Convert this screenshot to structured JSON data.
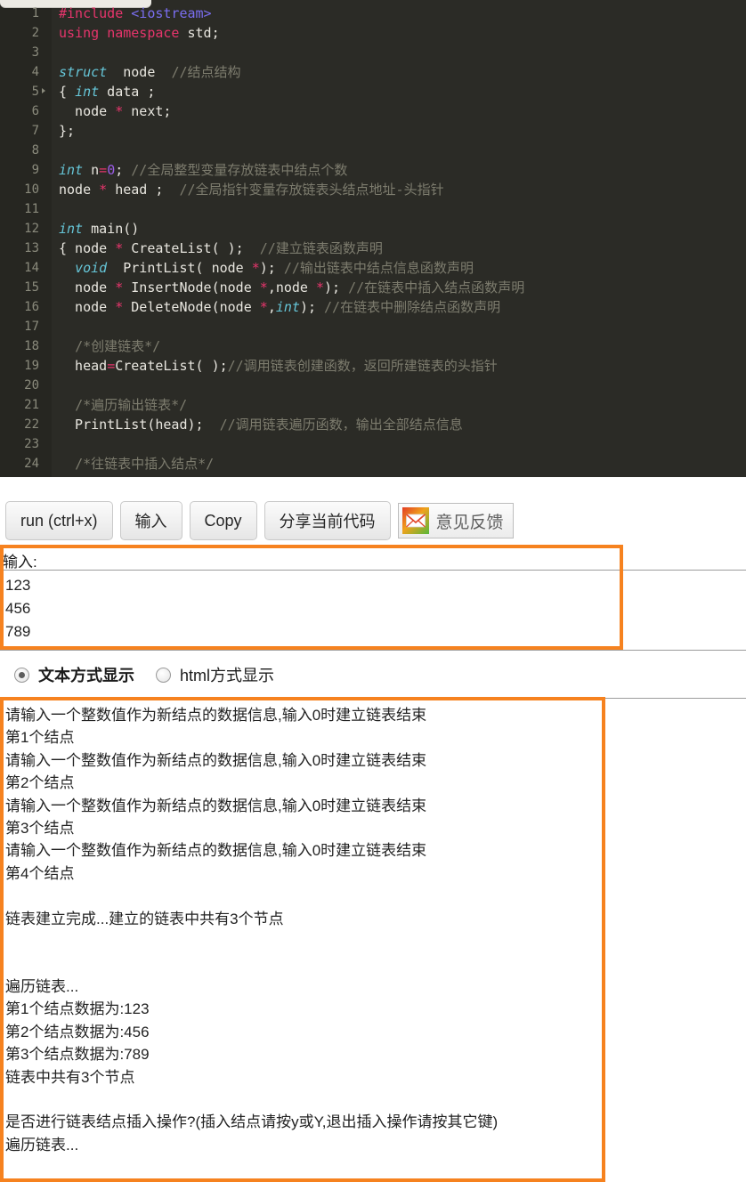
{
  "editor": {
    "language": "cpp",
    "colors": {
      "background": "#2b2b26",
      "gutter": "#262621",
      "text": "#e8e6df",
      "keyword": "#e6356c",
      "type": "#66c6d8",
      "string": "#7a6ef0",
      "number": "#9b5ce6",
      "comment": "#7d7c6e"
    },
    "lines": [
      {
        "n": "1",
        "fold": false,
        "tokens": [
          {
            "t": "#include",
            "c": "kw"
          },
          {
            "t": " ",
            "c": ""
          },
          {
            "t": "<iostream>",
            "c": "str"
          }
        ]
      },
      {
        "n": "2",
        "fold": false,
        "tokens": [
          {
            "t": "using",
            "c": "kw"
          },
          {
            "t": " ",
            "c": ""
          },
          {
            "t": "namespace",
            "c": "kw"
          },
          {
            "t": " std;",
            "c": ""
          }
        ]
      },
      {
        "n": "3",
        "fold": false,
        "tokens": []
      },
      {
        "n": "4",
        "fold": false,
        "tokens": [
          {
            "t": "struct",
            "c": "typ"
          },
          {
            "t": "  node  ",
            "c": ""
          },
          {
            "t": "//结点结构",
            "c": "cmt"
          }
        ]
      },
      {
        "n": "5",
        "fold": true,
        "tokens": [
          {
            "t": "{ ",
            "c": ""
          },
          {
            "t": "int",
            "c": "typ"
          },
          {
            "t": " data ;",
            "c": ""
          }
        ]
      },
      {
        "n": "6",
        "fold": false,
        "tokens": [
          {
            "t": "  node ",
            "c": ""
          },
          {
            "t": "*",
            "c": "op"
          },
          {
            "t": " next;",
            "c": ""
          }
        ]
      },
      {
        "n": "7",
        "fold": false,
        "tokens": [
          {
            "t": "};",
            "c": ""
          }
        ]
      },
      {
        "n": "8",
        "fold": false,
        "tokens": []
      },
      {
        "n": "9",
        "fold": false,
        "tokens": [
          {
            "t": "int",
            "c": "typ"
          },
          {
            "t": " n",
            "c": ""
          },
          {
            "t": "=",
            "c": "kw"
          },
          {
            "t": "0",
            "c": "num"
          },
          {
            "t": "; ",
            "c": ""
          },
          {
            "t": "//全局整型变量存放链表中结点个数",
            "c": "cmt"
          }
        ]
      },
      {
        "n": "10",
        "fold": false,
        "tokens": [
          {
            "t": "node ",
            "c": ""
          },
          {
            "t": "*",
            "c": "op"
          },
          {
            "t": " head ;  ",
            "c": ""
          },
          {
            "t": "//全局指针变量存放链表头结点地址-头指针",
            "c": "cmt"
          }
        ]
      },
      {
        "n": "11",
        "fold": false,
        "tokens": []
      },
      {
        "n": "12",
        "fold": false,
        "tokens": [
          {
            "t": "int",
            "c": "typ"
          },
          {
            "t": " main()",
            "c": ""
          }
        ]
      },
      {
        "n": "13",
        "fold": false,
        "tokens": [
          {
            "t": "{ node ",
            "c": ""
          },
          {
            "t": "*",
            "c": "op"
          },
          {
            "t": " CreateList( );  ",
            "c": ""
          },
          {
            "t": "//建立链表函数声明",
            "c": "cmt"
          }
        ]
      },
      {
        "n": "14",
        "fold": false,
        "tokens": [
          {
            "t": "  ",
            "c": ""
          },
          {
            "t": "void",
            "c": "typ"
          },
          {
            "t": "  PrintList( node ",
            "c": ""
          },
          {
            "t": "*",
            "c": "op"
          },
          {
            "t": "); ",
            "c": ""
          },
          {
            "t": "//输出链表中结点信息函数声明",
            "c": "cmt"
          }
        ]
      },
      {
        "n": "15",
        "fold": false,
        "tokens": [
          {
            "t": "  node ",
            "c": ""
          },
          {
            "t": "*",
            "c": "op"
          },
          {
            "t": " InsertNode(node ",
            "c": ""
          },
          {
            "t": "*",
            "c": "op"
          },
          {
            "t": ",node ",
            "c": ""
          },
          {
            "t": "*",
            "c": "op"
          },
          {
            "t": "); ",
            "c": ""
          },
          {
            "t": "//在链表中插入结点函数声明",
            "c": "cmt"
          }
        ]
      },
      {
        "n": "16",
        "fold": false,
        "tokens": [
          {
            "t": "  node ",
            "c": ""
          },
          {
            "t": "*",
            "c": "op"
          },
          {
            "t": " DeleteNode(node ",
            "c": ""
          },
          {
            "t": "*",
            "c": "op"
          },
          {
            "t": ",",
            "c": ""
          },
          {
            "t": "int",
            "c": "typ"
          },
          {
            "t": "); ",
            "c": ""
          },
          {
            "t": "//在链表中删除结点函数声明",
            "c": "cmt"
          }
        ]
      },
      {
        "n": "17",
        "fold": false,
        "tokens": []
      },
      {
        "n": "18",
        "fold": false,
        "tokens": [
          {
            "t": "  ",
            "c": ""
          },
          {
            "t": "/*创建链表*/",
            "c": "cmt"
          }
        ]
      },
      {
        "n": "19",
        "fold": false,
        "tokens": [
          {
            "t": "  head",
            "c": ""
          },
          {
            "t": "=",
            "c": "kw"
          },
          {
            "t": "CreateList( );",
            "c": ""
          },
          {
            "t": "//调用链表创建函数，返回所建链表的头指针",
            "c": "cmt"
          }
        ]
      },
      {
        "n": "20",
        "fold": false,
        "tokens": []
      },
      {
        "n": "21",
        "fold": false,
        "tokens": [
          {
            "t": "  ",
            "c": ""
          },
          {
            "t": "/*遍历输出链表*/",
            "c": "cmt"
          }
        ]
      },
      {
        "n": "22",
        "fold": false,
        "tokens": [
          {
            "t": "  PrintList(head);  ",
            "c": ""
          },
          {
            "t": "//调用链表遍历函数，输出全部结点信息",
            "c": "cmt"
          }
        ]
      },
      {
        "n": "23",
        "fold": false,
        "tokens": []
      },
      {
        "n": "24",
        "fold": false,
        "tokens": [
          {
            "t": "  ",
            "c": ""
          },
          {
            "t": "/*往链表中插入结点*/",
            "c": "cmt"
          }
        ]
      }
    ]
  },
  "toolbar": {
    "run_label": "run (ctrl+x)",
    "input_label": "输入",
    "copy_label": "Copy",
    "share_label": "分享当前代码",
    "feedback_label": "意见反馈",
    "feedback_icon": "envelope-icon"
  },
  "input_panel": {
    "label": "输入:",
    "lines": [
      "123",
      "456",
      "789"
    ]
  },
  "display_mode": {
    "options": [
      {
        "label": "文本方式显示",
        "selected": true
      },
      {
        "label": "html方式显示",
        "selected": false
      }
    ]
  },
  "output_panel": {
    "text": "请输入一个整数值作为新结点的数据信息,输入0时建立链表结束\n第1个结点\n请输入一个整数值作为新结点的数据信息,输入0时建立链表结束\n第2个结点\n请输入一个整数值作为新结点的数据信息,输入0时建立链表结束\n第3个结点\n请输入一个整数值作为新结点的数据信息,输入0时建立链表结束\n第4个结点\n\n链表建立完成...建立的链表中共有3个节点\n\n\n遍历链表...\n第1个结点数据为:123\n第2个结点数据为:456\n第3个结点数据为:789\n链表中共有3个节点\n\n是否进行链表结点插入操作?(插入结点请按y或Y,退出插入操作请按其它键)\n遍历链表..."
  },
  "annotations": {
    "color": "#f6821f",
    "boxes": [
      "input-area-highlight",
      "output-area-highlight"
    ]
  }
}
